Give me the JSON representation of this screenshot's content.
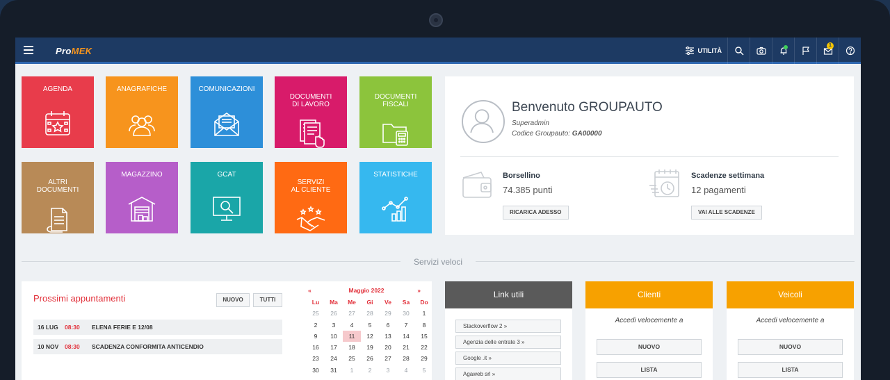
{
  "app": {
    "logo_pro": "Pro",
    "logo_mek": "MEK",
    "menu_icon": "hamburger-icon"
  },
  "topbar": {
    "utility_label": "UTILITÀ",
    "notification_badge": "1",
    "icons": [
      "sliders-icon",
      "search-icon",
      "camera-icon",
      "bell-icon",
      "flag-icon",
      "mail-icon",
      "help-icon"
    ]
  },
  "tiles": [
    {
      "label": "AGENDA",
      "color": "#e83c4b",
      "icon": "calendar-icon"
    },
    {
      "label": "ANAGRAFICHE",
      "color": "#f7941d",
      "icon": "people-icon"
    },
    {
      "label": "COMUNICAZIONI",
      "color": "#2d8fd9",
      "icon": "envelope-icon"
    },
    {
      "label": "DOCUMENTI\nDI LAVORO",
      "color": "#d81b6a",
      "icon": "document-touch-icon"
    },
    {
      "label": "DOCUMENTI\nFISCALI",
      "color": "#8cc43c",
      "icon": "folder-calculator-icon"
    },
    {
      "label": "ALTRI\nDOCUMENTI",
      "color": "#b88a57",
      "icon": "documents-icon"
    },
    {
      "label": "MAGAZZINO",
      "color": "#b65ec9",
      "icon": "warehouse-icon"
    },
    {
      "label": "GCAT",
      "color": "#1aa6a8",
      "icon": "monitor-search-icon"
    },
    {
      "label": "SERVIZI\nAL CLIENTE",
      "color": "#ff6a13",
      "icon": "handshake-icon"
    },
    {
      "label": "STATISTICHE",
      "color": "#36b8ef",
      "icon": "chart-icon"
    }
  ],
  "welcome": {
    "title": "Benvenuto GROUPAUTO",
    "role": "Superadmin",
    "code_label": "Codice Groupauto:",
    "code_value": "GA00000",
    "wallet": {
      "title": "Borsellino",
      "value": "74.385 punti",
      "button": "RICARICA ADESSO"
    },
    "deadlines": {
      "title": "Scadenze settimana",
      "value": "12 pagamenti",
      "button": "VAI ALLE SCADENZE"
    }
  },
  "quick_services_label": "Servizi veloci",
  "appointments": {
    "title": "Prossimi appuntamenti",
    "new_button": "NUOVO",
    "all_button": "TUTTI",
    "rows": [
      {
        "date": "16 LUG",
        "time": "08:30",
        "name": "ELENA FERIE E 12/08"
      },
      {
        "date": "10 NOV",
        "time": "08:30",
        "name": "SCADENZA CONFORMITA ANTICENDIO"
      }
    ]
  },
  "calendar": {
    "prev": "«",
    "next": "»",
    "month": "Maggio 2022",
    "day_names": [
      "Lu",
      "Ma",
      "Me",
      "Gi",
      "Ve",
      "Sa",
      "Do"
    ],
    "days": [
      "25",
      "26",
      "27",
      "28",
      "29",
      "30",
      "1",
      "2",
      "3",
      "4",
      "5",
      "6",
      "7",
      "8",
      "9",
      "10",
      "11",
      "12",
      "13",
      "14",
      "15",
      "16",
      "17",
      "18",
      "19",
      "20",
      "21",
      "22",
      "23",
      "24",
      "25",
      "26",
      "27",
      "28",
      "29",
      "30",
      "31",
      "1",
      "2",
      "3",
      "4",
      "5"
    ],
    "other_month_indices": [
      0,
      1,
      2,
      3,
      4,
      5,
      37,
      38,
      39,
      40,
      41
    ],
    "today_index": 16
  },
  "links": {
    "title": "Link utili",
    "header_color": "#5a5a5a",
    "items": [
      "Stackoverflow 2 »",
      "Agenzia delle entrate 3 »",
      "Google .it »",
      "Agaweb srl »"
    ]
  },
  "clients": {
    "title": "Clienti",
    "header_color": "#f7a100",
    "subtitle": "Accedi velocemente a",
    "new_button": "NUOVO",
    "list_button": "LISTA"
  },
  "vehicles": {
    "title": "Veicoli",
    "header_color": "#f7a100",
    "subtitle": "Accedi velocemente a",
    "new_button": "NUOVO",
    "list_button": "LISTA"
  }
}
